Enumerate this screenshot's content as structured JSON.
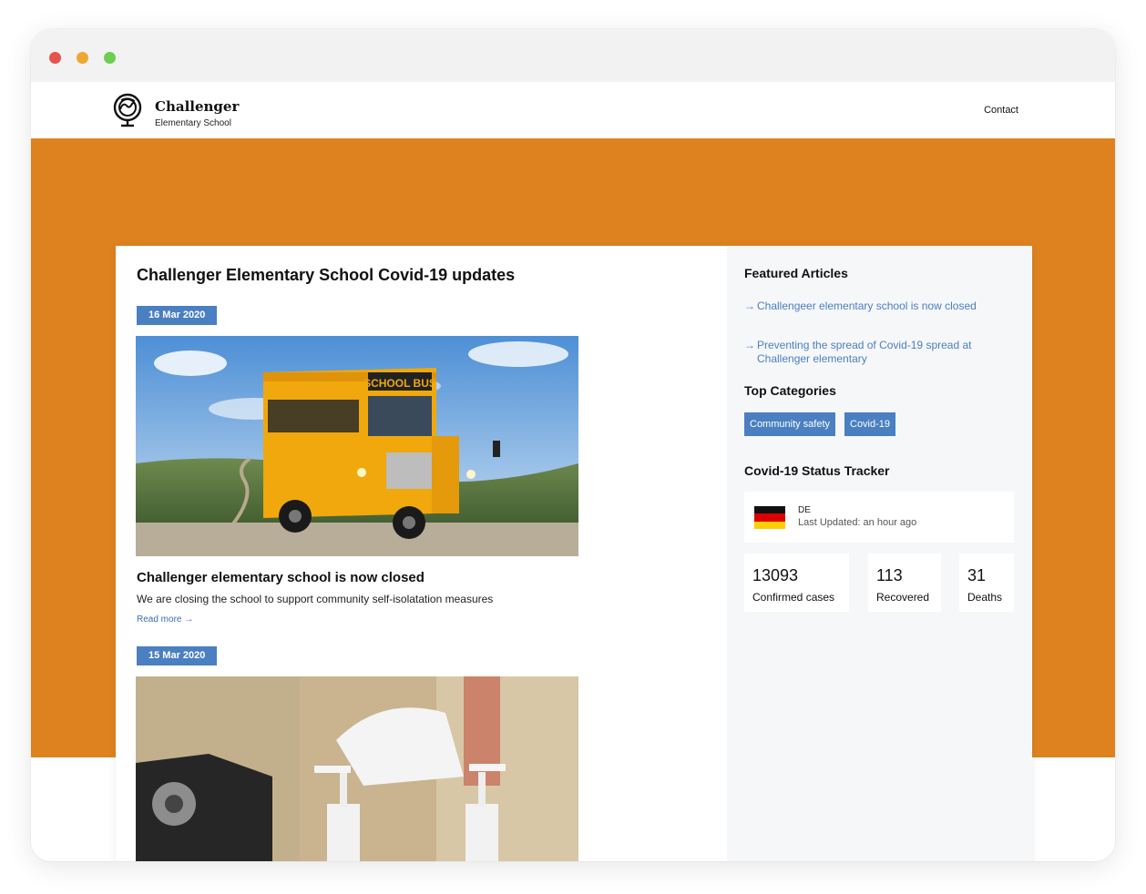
{
  "site": {
    "brand_name": "Challenger",
    "brand_sub": "Elementary School",
    "nav_contact": "Contact"
  },
  "main": {
    "title": "Challenger Elementary School Covid-19 updates",
    "posts": [
      {
        "date": "16 Mar 2020",
        "image_desc": "school-bus-photo",
        "title": "Challenger elementary school is now closed",
        "excerpt": "We are closing the school to support community self-isolatation measures",
        "read_more": "Read more →"
      },
      {
        "date": "15 Mar 2020",
        "image_desc": "hand-sanitizer-photo"
      }
    ]
  },
  "sidebar": {
    "featured_heading": "Featured Articles",
    "featured": [
      {
        "arrow": "→",
        "label": "Challengeer elementary school is now closed"
      },
      {
        "arrow": "→",
        "label": "Preventing the spread of Covid-19 spread at Challenger elementary"
      }
    ],
    "categories_heading": "Top Categories",
    "categories": [
      "Community safety",
      "Covid-19"
    ],
    "tracker_heading": "Covid-19 Status Tracker",
    "tracker": {
      "country": "DE",
      "updated": "Last Updated: an hour ago",
      "flag_colors": [
        "#111111",
        "#dd0000",
        "#ffce00"
      ],
      "stats": [
        {
          "value": "13093",
          "label": "Confirmed cases"
        },
        {
          "value": "113",
          "label": "Recovered"
        },
        {
          "value": "31",
          "label": "Deaths"
        }
      ]
    }
  },
  "colors": {
    "hero": "#de821f",
    "accent": "#4a7fc1"
  }
}
